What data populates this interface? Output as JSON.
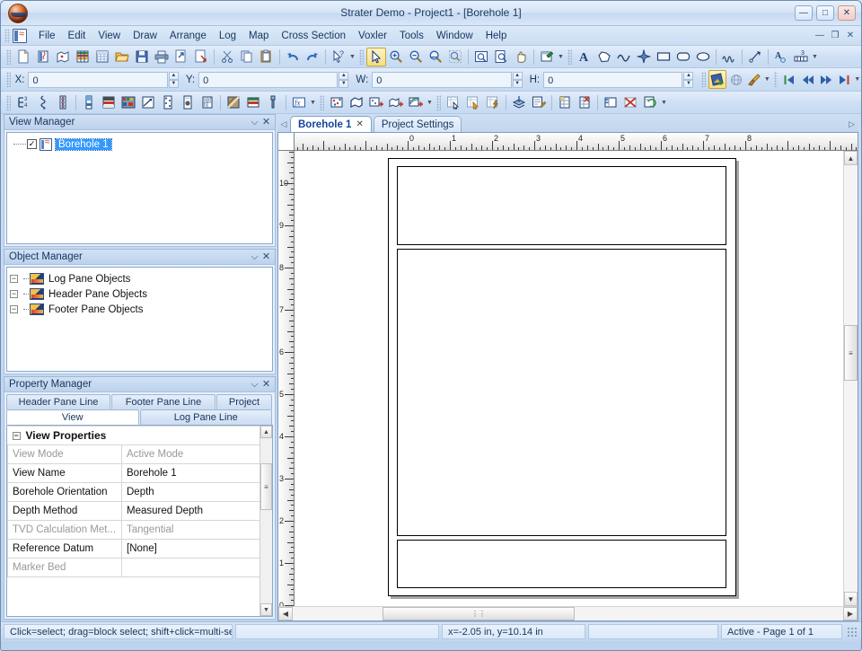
{
  "window": {
    "title": "Strater Demo - Project1 - [Borehole 1]",
    "minimize_label": "—",
    "maximize_label": "□",
    "close_label": "✕",
    "mdi_restore_label": "—",
    "mdi_maximize_label": "❐",
    "mdi_close_label": "✕"
  },
  "menu": {
    "items": [
      {
        "label": "File"
      },
      {
        "label": "Edit"
      },
      {
        "label": "View"
      },
      {
        "label": "Draw"
      },
      {
        "label": "Arrange"
      },
      {
        "label": "Log"
      },
      {
        "label": "Map"
      },
      {
        "label": "Cross Section"
      },
      {
        "label": "Voxler"
      },
      {
        "label": "Tools"
      },
      {
        "label": "Window"
      },
      {
        "label": "Help"
      }
    ]
  },
  "toolbar_standard": {
    "buttons": [
      {
        "name": "new-icon"
      },
      {
        "name": "new-borehole-view-icon"
      },
      {
        "name": "new-map-view-icon"
      },
      {
        "name": "new-cross-section-view-icon"
      },
      {
        "name": "new-table-icon"
      },
      {
        "name": "open-icon"
      },
      {
        "name": "save-icon"
      },
      {
        "name": "print-icon"
      },
      {
        "name": "export-icon"
      },
      {
        "name": "print-preview-icon"
      },
      {
        "name": "cut-icon"
      },
      {
        "name": "copy-icon"
      },
      {
        "name": "paste-icon"
      },
      {
        "name": "undo-icon"
      },
      {
        "name": "redo-icon"
      },
      {
        "name": "help-pointer-icon"
      }
    ]
  },
  "toolbar_view": {
    "buttons": [
      {
        "name": "select-arrow-icon",
        "active": true
      },
      {
        "name": "zoom-in-icon"
      },
      {
        "name": "zoom-out-icon"
      },
      {
        "name": "zoom-selected-icon"
      },
      {
        "name": "zoom-rectangle-icon"
      },
      {
        "name": "fit-to-window-icon"
      },
      {
        "name": "zoom-page-icon"
      },
      {
        "name": "pan-hand-icon"
      },
      {
        "name": "refresh-window-icon"
      }
    ]
  },
  "toolbar_draw": {
    "buttons": [
      {
        "name": "text-icon"
      },
      {
        "name": "polygon-icon"
      },
      {
        "name": "polyline-icon"
      },
      {
        "name": "symbol-icon"
      },
      {
        "name": "rectangle-icon"
      },
      {
        "name": "rounded-rectangle-icon"
      },
      {
        "name": "ellipse-icon"
      },
      {
        "name": "spline-icon"
      },
      {
        "name": "reshape-icon"
      },
      {
        "name": "label-icon"
      },
      {
        "name": "scalebar-icon"
      }
    ]
  },
  "toolbar_coords": {
    "fields": [
      {
        "label": "X:",
        "value": "0",
        "name": "x-field"
      },
      {
        "label": "Y:",
        "value": "0",
        "name": "y-field"
      },
      {
        "label": "W:",
        "value": "0",
        "name": "width-field"
      },
      {
        "label": "H:",
        "value": "0",
        "name": "height-field"
      }
    ]
  },
  "toolbar_tools": {
    "buttons": [
      {
        "name": "color-fill-icon",
        "active": true
      },
      {
        "name": "globe-icon"
      },
      {
        "name": "paintbrush-icon"
      }
    ]
  },
  "toolbar_navigate": {
    "buttons": [
      {
        "name": "first-borehole-icon"
      },
      {
        "name": "previous-borehole-icon"
      },
      {
        "name": "next-borehole-icon"
      },
      {
        "name": "last-borehole-icon"
      }
    ]
  },
  "toolbar_logs": {
    "buttons": [
      {
        "name": "depth-log-icon"
      },
      {
        "name": "line-log-icon"
      },
      {
        "name": "lithology-log-icon"
      },
      {
        "name": "bar-log-icon"
      },
      {
        "name": "keyword-log-icon"
      },
      {
        "name": "percentage-log-icon"
      },
      {
        "name": "crossplot-log-icon"
      },
      {
        "name": "complex-text-log-icon"
      },
      {
        "name": "post-log-icon"
      },
      {
        "name": "zone-bar-log-icon"
      },
      {
        "name": "classed-post-log-icon"
      },
      {
        "name": "well-construction-log-icon"
      },
      {
        "name": "function-log-icon"
      }
    ]
  },
  "toolbar_map": {
    "buttons": [
      {
        "name": "post-map-icon"
      },
      {
        "name": "base-map-icon"
      },
      {
        "name": "add-post-map-icon"
      },
      {
        "name": "add-base-map-icon"
      },
      {
        "name": "add-contour-map-icon"
      }
    ]
  },
  "toolbar_table": {
    "buttons": [
      {
        "name": "open-data-table-icon"
      },
      {
        "name": "open-collars-table-icon"
      },
      {
        "name": "open-scheme-editor-icon"
      },
      {
        "name": "import-data-icon"
      },
      {
        "name": "edit-data-icon"
      },
      {
        "name": "insert-row-icon"
      },
      {
        "name": "insert-column-icon"
      },
      {
        "name": "delete-row-icon"
      },
      {
        "name": "delete-column-icon"
      },
      {
        "name": "refresh-data-icon"
      }
    ]
  },
  "view_manager": {
    "title": "View Manager",
    "pin_label": "⌵",
    "close_label": "✕",
    "tree": [
      {
        "label": "Borehole 1",
        "checked": true,
        "selected": true
      }
    ]
  },
  "object_manager": {
    "title": "Object Manager",
    "pin_label": "⌵",
    "close_label": "✕",
    "tree": [
      {
        "label": "Log Pane Objects",
        "expander": "−"
      },
      {
        "label": "Header Pane Objects",
        "expander": "−"
      },
      {
        "label": "Footer Pane Objects",
        "expander": "−"
      }
    ]
  },
  "property_manager": {
    "title": "Property Manager",
    "pin_label": "⌵",
    "close_label": "✕",
    "tabs_row1": [
      {
        "label": "Header Pane Line",
        "selected": false
      },
      {
        "label": "Footer Pane Line",
        "selected": false
      },
      {
        "label": "Project",
        "selected": false
      }
    ],
    "tabs_row2": [
      {
        "label": "View",
        "selected": true
      },
      {
        "label": "Log Pane Line",
        "selected": false
      }
    ],
    "group_header": "View Properties",
    "group_expander": "−",
    "rows": [
      {
        "name": "View Mode",
        "value": "Active Mode",
        "dim": true
      },
      {
        "name": "View Name",
        "value": "Borehole 1",
        "dim": false
      },
      {
        "name": "Borehole Orientation",
        "value": "Depth",
        "dim": false
      },
      {
        "name": "Depth Method",
        "value": "Measured Depth",
        "dim": false
      },
      {
        "name": "TVD Calculation Met...",
        "value": "Tangential",
        "dim": true
      },
      {
        "name": "Reference Datum",
        "value": "[None]",
        "dim": false
      },
      {
        "name": "Marker Bed",
        "value": "",
        "dim": true
      }
    ],
    "scroll_up_label": "▲",
    "scroll_down_label": "▼",
    "scroll_thumb_label": "≡"
  },
  "document_tabs": {
    "nav_left_label": "◁",
    "nav_right_label": "▷",
    "tabs": [
      {
        "label": "Borehole 1",
        "active": true,
        "closable": true,
        "close_label": "✕"
      },
      {
        "label": "Project Settings",
        "active": false,
        "closable": false
      }
    ]
  },
  "canvas": {
    "ruler_h_labels": [
      "0",
      "1",
      "2",
      "3",
      "4",
      "5",
      "6",
      "7",
      "8"
    ],
    "ruler_v_labels": [
      "10",
      "9",
      "8",
      "7",
      "6",
      "5",
      "4",
      "3",
      "2",
      "1",
      "0"
    ],
    "ruler_units": "in",
    "panes": [
      {
        "name": "header-pane"
      },
      {
        "name": "log-pane"
      },
      {
        "name": "footer-pane"
      }
    ],
    "vscroll_up_label": "▲",
    "vscroll_down_label": "▼",
    "vscroll_thumb_label": "≡",
    "hscroll_left_label": "◀",
    "hscroll_right_label": "▶",
    "hscroll_thumb_label": "⋮⋮"
  },
  "statusbar": {
    "hint": "Click=select; drag=block select; shift+click=multi-sele",
    "coordinates": "x=-2.05 in, y=10.14 in",
    "blank": "",
    "page_status": "Active - Page 1 of 1"
  }
}
